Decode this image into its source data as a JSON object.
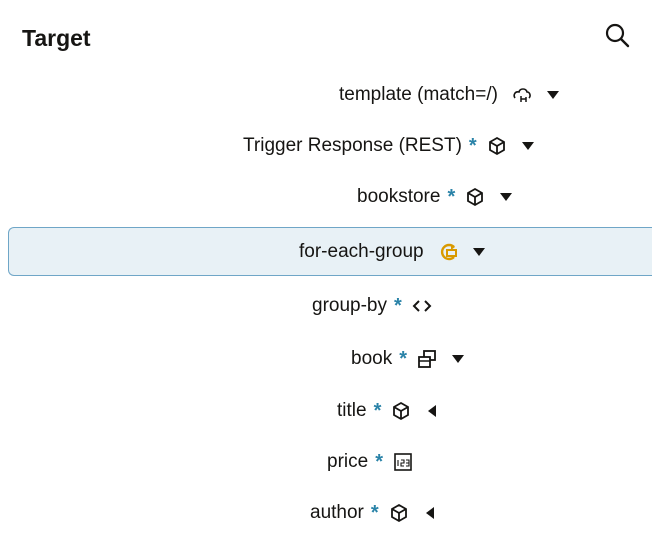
{
  "header": {
    "title": "Target",
    "search_icon": "search-icon"
  },
  "nodes": [
    {
      "label": "template (match=/)",
      "required": false,
      "icon": "template-icon",
      "expander": "down"
    },
    {
      "label": "Trigger Response (REST)",
      "required": true,
      "icon": "cube-icon",
      "expander": "down"
    },
    {
      "label": "bookstore",
      "required": true,
      "icon": "cube-icon",
      "expander": "down"
    },
    {
      "label": "for-each-group",
      "required": false,
      "icon": "for-each-group-icon",
      "expander": "down",
      "selected": true
    },
    {
      "label": "group-by",
      "required": true,
      "icon": "code-icon",
      "expander": "none"
    },
    {
      "label": "book",
      "required": true,
      "icon": "repeating-element-icon",
      "expander": "down"
    },
    {
      "label": "title",
      "required": true,
      "icon": "cube-icon",
      "expander": "left"
    },
    {
      "label": "price",
      "required": true,
      "icon": "number-icon",
      "expander": "none"
    },
    {
      "label": "author",
      "required": true,
      "icon": "cube-icon",
      "expander": "left"
    }
  ],
  "star": "*",
  "colors": {
    "accent": "#2a83a8",
    "selected_bg": "#e8f1f6",
    "selected_border": "#6fa6c7",
    "loop_icon": "#d99a00"
  }
}
